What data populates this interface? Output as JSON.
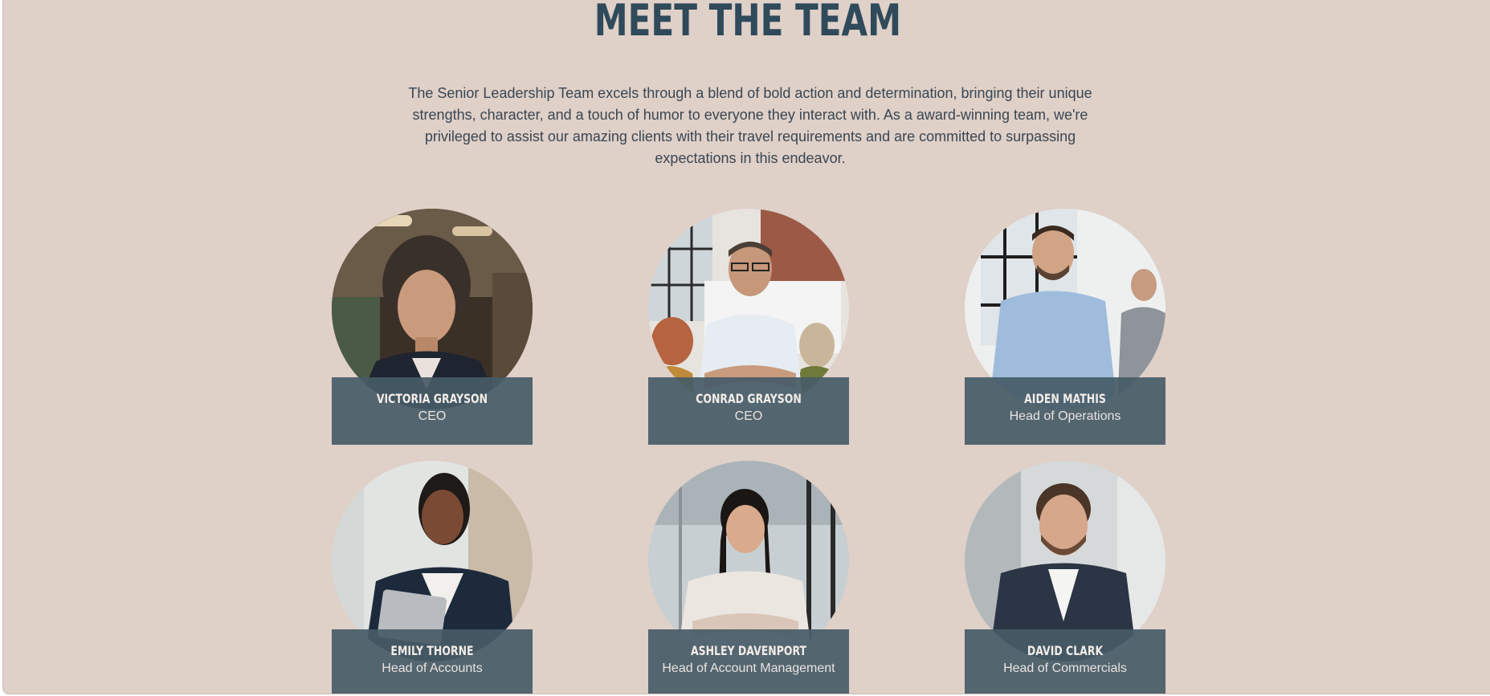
{
  "section": {
    "title": "MEET THE TEAM",
    "intro": "The Senior Leadership Team excels through a blend of bold action and determination, bringing their unique strengths, character, and a touch of humor to everyone they interact with. As a award-winning team, we're privileged to assist our amazing clients with their travel requirements and are committed to surpassing expectations in this endeavor."
  },
  "team": [
    {
      "name": "VICTORIA GRAYSON",
      "role": "CEO"
    },
    {
      "name": "CONRAD GRAYSON",
      "role": "CEO"
    },
    {
      "name": "AIDEN MATHIS",
      "role": "Head of Operations"
    },
    {
      "name": "EMILY THORNE",
      "role": "Head of Accounts"
    },
    {
      "name": "ASHLEY DAVENPORT",
      "role": "Head of Account Management"
    },
    {
      "name": "DAVID CLARK",
      "role": "Head of Commercials"
    }
  ],
  "colors": {
    "background": "#dfd0c8",
    "title": "#2f4a5a",
    "label_box": "#465b67"
  }
}
